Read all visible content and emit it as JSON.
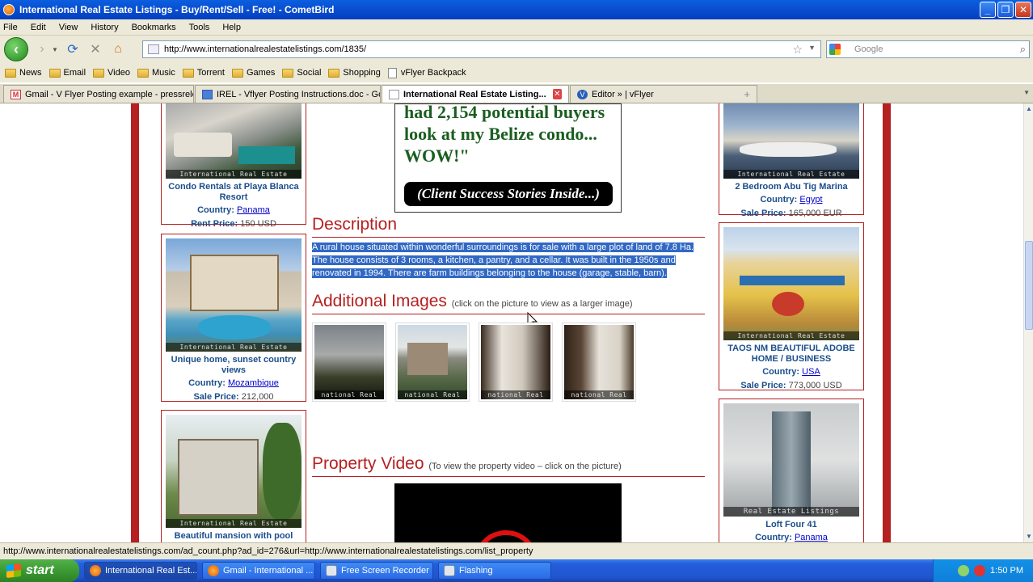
{
  "window": {
    "title": "International Real Estate Listings - Buy/Rent/Sell - Free! - CometBird"
  },
  "menu": [
    "File",
    "Edit",
    "View",
    "History",
    "Bookmarks",
    "Tools",
    "Help"
  ],
  "nav": {
    "url": "http://www.internationalrealestatelistings.com/1835/",
    "search_placeholder": "Google"
  },
  "bookmarks": [
    {
      "label": "News",
      "icon": "folder-icon"
    },
    {
      "label": "Email",
      "icon": "folder-icon"
    },
    {
      "label": "Video",
      "icon": "folder-icon"
    },
    {
      "label": "Music",
      "icon": "folder-icon"
    },
    {
      "label": "Torrent",
      "icon": "folder-icon"
    },
    {
      "label": "Games",
      "icon": "folder-icon"
    },
    {
      "label": "Social",
      "icon": "folder-icon"
    },
    {
      "label": "Shopping",
      "icon": "folder-icon"
    },
    {
      "label": "vFlyer Backpack",
      "icon": "page-icon"
    }
  ],
  "tabs": [
    {
      "label": "Gmail - V Flyer Posting example - pressrelea...",
      "icon": "gmail-icon"
    },
    {
      "label": "IREL - Vflyer Posting Instructions.doc - Goo...",
      "icon": "doc-icon"
    },
    {
      "label": "International Real Estate Listing...",
      "icon": "page-icon",
      "active": true
    },
    {
      "label": "Editor » | vFlyer",
      "icon": "vflyer-icon"
    }
  ],
  "left_listings": [
    {
      "watermark": "International Real Estate Listings",
      "title": "Condo Rentals at Playa Blanca Resort",
      "country_label": "Country:",
      "country": "Panama",
      "price_label": "Rent Price:",
      "price": "150 USD"
    },
    {
      "watermark": "International Real Estate Listings",
      "title": "Unique home, sunset country views",
      "country_label": "Country:",
      "country": "Mozambique",
      "price_label": "Sale Price:",
      "price": "212,000"
    },
    {
      "watermark": "International Real Estate Listings",
      "title": "Beautiful mansion with pool"
    }
  ],
  "right_listings": [
    {
      "watermark": "International Real Estate Listings",
      "title": "2 Bedroom Abu Tig Marina",
      "country_label": "Country:",
      "country": "Egypt",
      "price_label": "Sale Price:",
      "price": "165,000 EUR"
    },
    {
      "watermark": "International Real Estate Listings",
      "title": "TAOS NM BEAUTIFUL ADOBE HOME / BUSINESS",
      "country_label": "Country:",
      "country": "USA",
      "price_label": "Sale Price:",
      "price": "773,000 USD"
    },
    {
      "watermark": "Real Estate Listings",
      "title": "Loft Four 41",
      "country_label": "Country:",
      "country": "Panama"
    }
  ],
  "testimonial": {
    "lines": [
      "had 2,154 potential buyers",
      "look at my Belize condo...",
      "WOW!\""
    ],
    "button": "(Client Success Stories Inside...)"
  },
  "description": {
    "heading": "Description",
    "text": "A rural house situated within wonderful surroundings is for sale with a large plot of land of 7.8 Ha. The house consists of 3 rooms, a kitchen, a pantry, and a cellar. It was built in the 1950s and renovated in 1994. There are farm buildings belonging to the house (garage, stable, barn)."
  },
  "additional_images": {
    "heading": "Additional Images",
    "note": "(click on the picture to view as a larger image)",
    "watermark": "national Real Estate Listings"
  },
  "property_video": {
    "heading": "Property Video",
    "note": "(To view the property video – click on the picture)"
  },
  "status": {
    "text": "http://www.internationalrealestatelistings.com/ad_count.php?ad_id=276&url=http://www.internationalrealestatelistings.com/list_property"
  },
  "taskbar": {
    "start": "start",
    "tasks": [
      "International Real Est...",
      "Gmail - International ...",
      "Free Screen Recorder",
      "Flashing"
    ],
    "clock": "1:50 PM"
  },
  "colors": {
    "brand_red": "#b52020",
    "listing_title_blue": "#1a4e8c",
    "selection_blue": "#3168c4",
    "quote_green": "#1b5e20"
  }
}
